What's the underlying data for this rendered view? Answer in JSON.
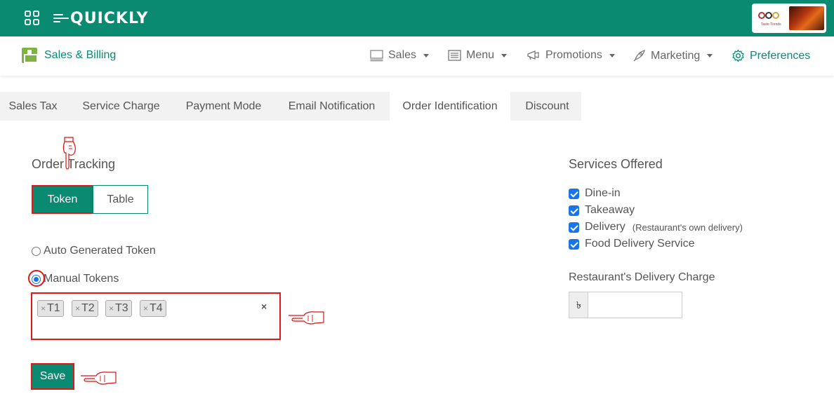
{
  "topbar": {
    "logo_text": "QUICKLY",
    "brand_logo_text": "Taste Trends"
  },
  "subnav": {
    "app_title": "Sales & Billing",
    "items": [
      {
        "label": "Sales",
        "icon": "monitor-icon"
      },
      {
        "label": "Menu",
        "icon": "list-icon"
      },
      {
        "label": "Promotions",
        "icon": "megaphone-icon"
      },
      {
        "label": "Marketing",
        "icon": "rocket-icon"
      },
      {
        "label": "Preferences",
        "icon": "gear-icon"
      }
    ]
  },
  "tabs": [
    {
      "label": "Sales Tax"
    },
    {
      "label": "Service Charge"
    },
    {
      "label": "Payment Mode"
    },
    {
      "label": "Email Notification"
    },
    {
      "label": "Order Identification",
      "active": true
    },
    {
      "label": "Discount"
    }
  ],
  "order_tracking": {
    "title": "Order Tracking",
    "token_label": "Token",
    "table_label": "Table",
    "auto_label": "Auto Generated Token",
    "manual_label": "Manual Tokens",
    "manual_selected": true,
    "tokens": [
      "T1",
      "T2",
      "T3",
      "T4"
    ],
    "save_label": "Save"
  },
  "services": {
    "title": "Services Offered",
    "options": [
      {
        "label": "Dine-in",
        "checked": true
      },
      {
        "label": "Takeaway",
        "checked": true
      },
      {
        "label": "Delivery",
        "note": "(Restaurant's own delivery)",
        "checked": true
      },
      {
        "label": "Food Delivery Service",
        "checked": true
      }
    ],
    "delivery_charge_label": "Restaurant's Delivery Charge",
    "currency_symbol": "৳",
    "delivery_charge_value": ""
  },
  "colors": {
    "primary": "#0b8a72",
    "highlight": "#e01818",
    "checkbox": "#1a73e8"
  }
}
